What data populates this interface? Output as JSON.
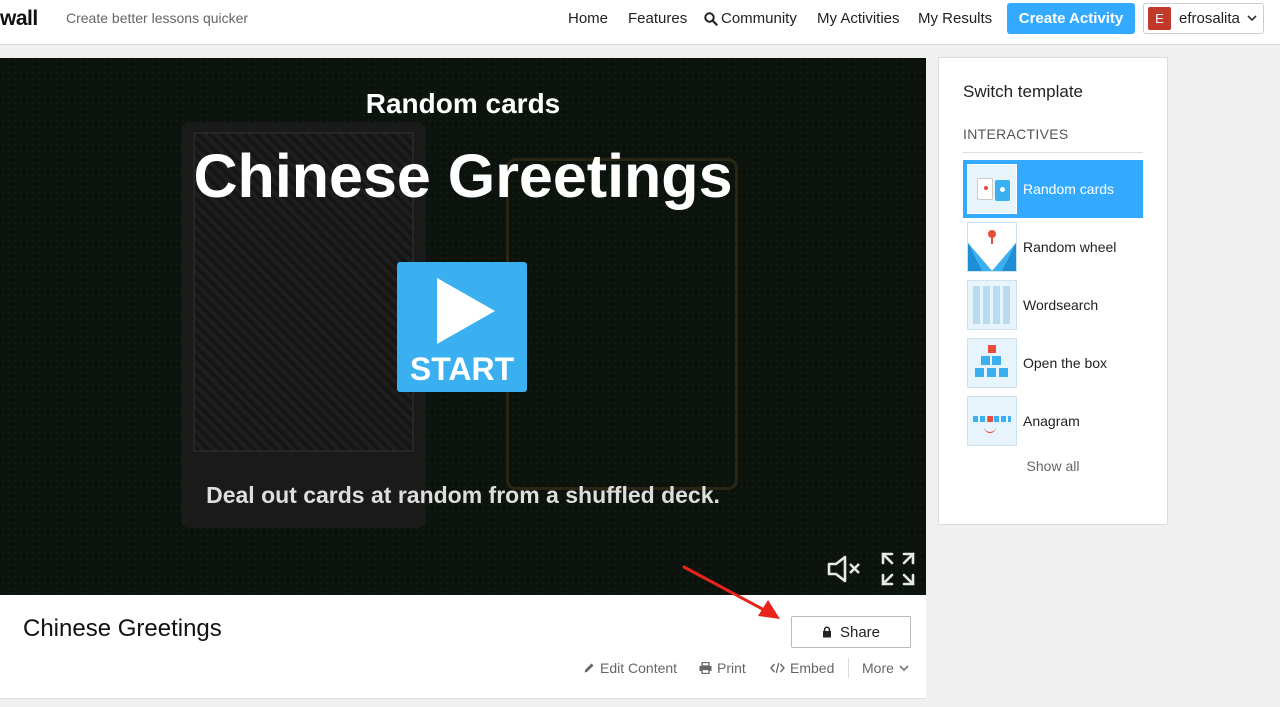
{
  "header": {
    "logo": "wall",
    "tagline": "Create better lessons quicker",
    "nav": {
      "home": "Home",
      "features": "Features",
      "community": "Community",
      "my_activities": "My Activities",
      "my_results": "My Results"
    },
    "create_activity": "Create Activity",
    "user": {
      "initial": "E",
      "name": "efrosalita"
    }
  },
  "stage": {
    "template_name": "Random cards",
    "title": "Chinese Greetings",
    "start_label": "START",
    "description": "Deal out cards at random from a shuffled deck."
  },
  "activity": {
    "title": "Chinese Greetings",
    "share_label": "Share",
    "actions": {
      "edit": "Edit Content",
      "print": "Print",
      "embed": "Embed",
      "more": "More"
    }
  },
  "sidebar": {
    "title": "Switch template",
    "section": "INTERACTIVES",
    "templates": [
      {
        "label": "Random cards",
        "active": true
      },
      {
        "label": "Random wheel",
        "active": false
      },
      {
        "label": "Wordsearch",
        "active": false
      },
      {
        "label": "Open the box",
        "active": false
      },
      {
        "label": "Anagram",
        "active": false
      }
    ],
    "show_all": "Show all"
  },
  "colors": {
    "accent": "#33aaff",
    "stage_bg": "#0c130c",
    "avatar": "#c0392b",
    "annotation_arrow": "#e8231c"
  }
}
